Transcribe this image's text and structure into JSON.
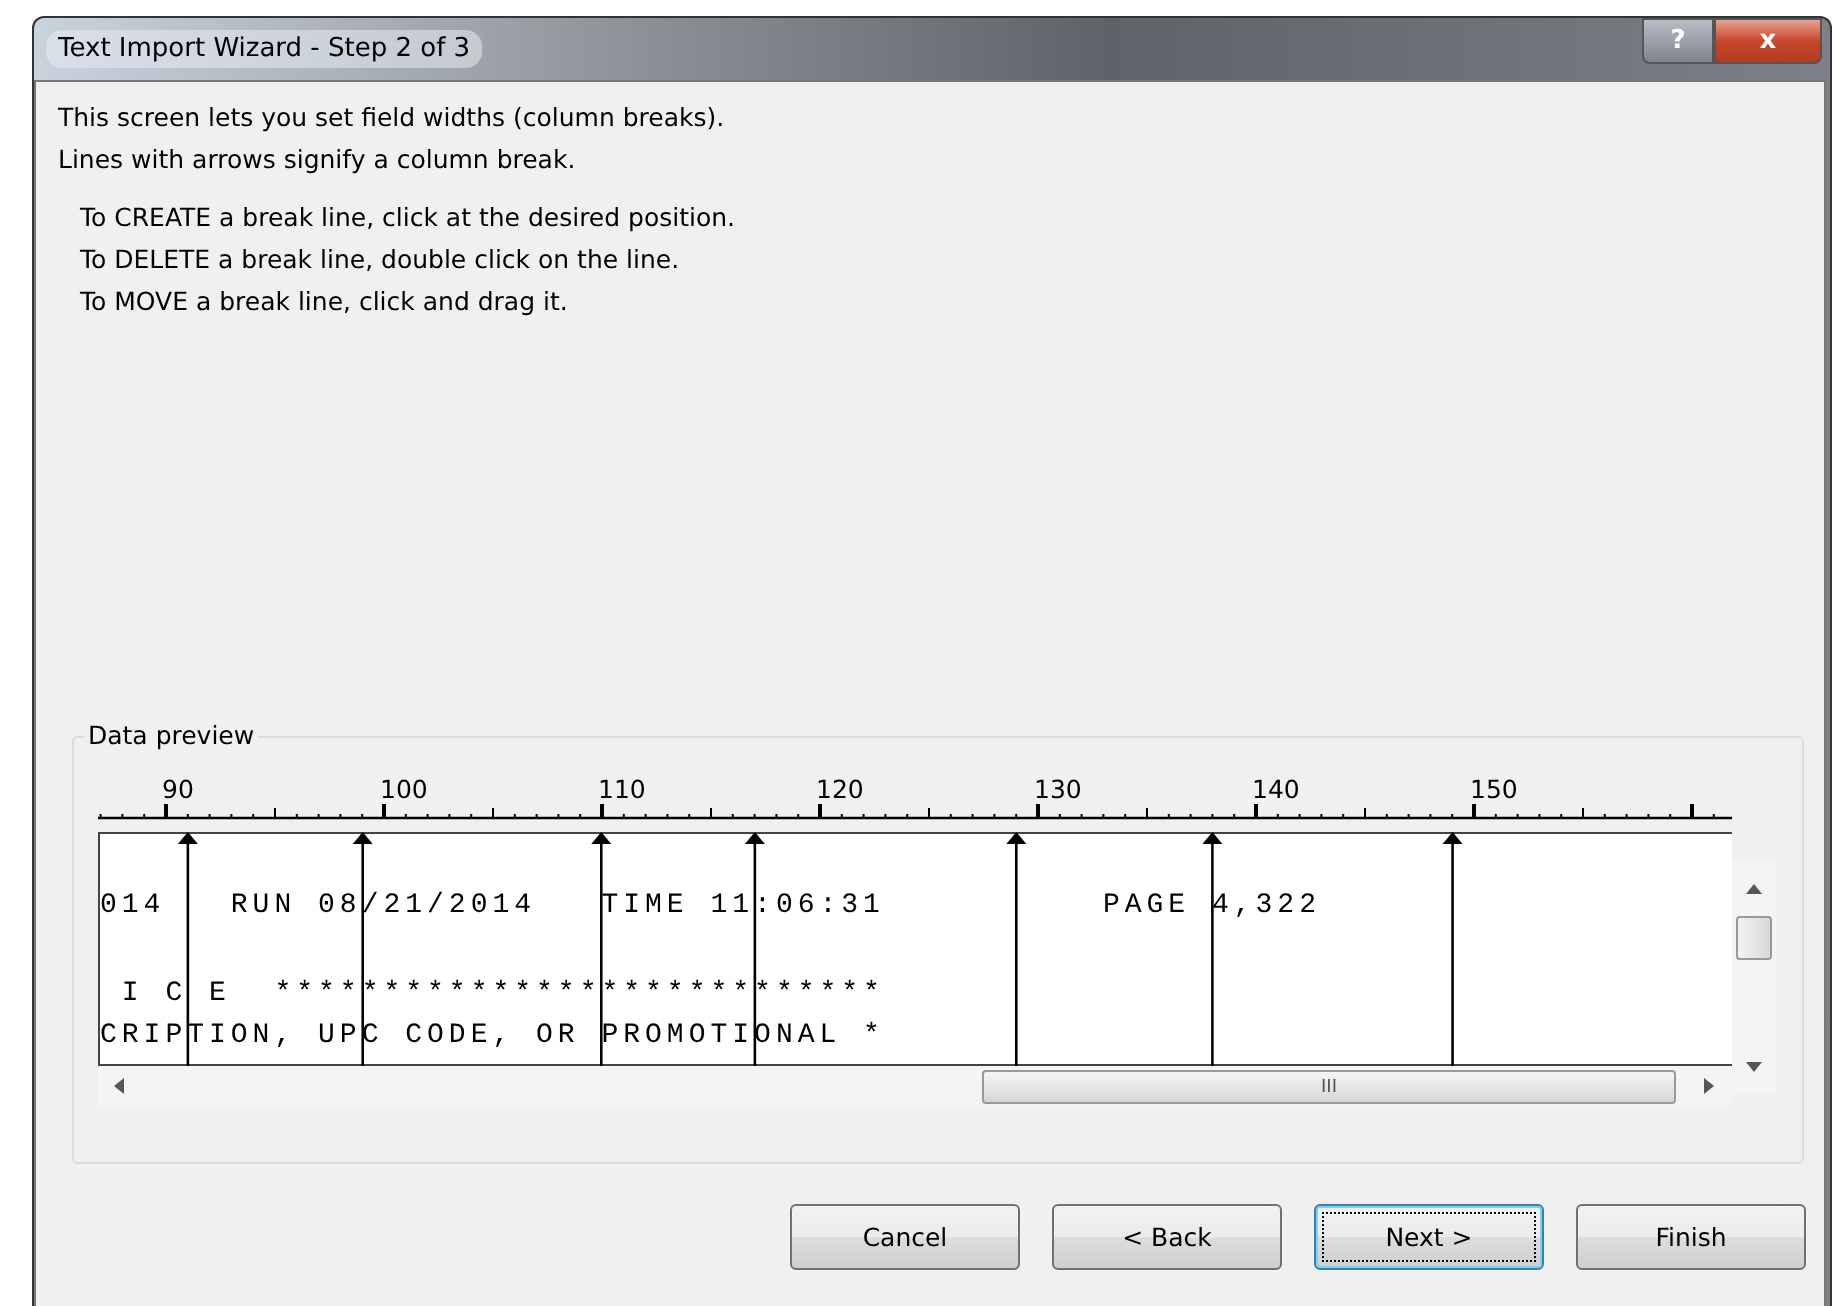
{
  "window": {
    "title": "Text Import Wizard - Step 2 of 3",
    "help_label": "?",
    "close_label": "x"
  },
  "intro": [
    "This screen lets you set field widths (column breaks).",
    "Lines with arrows signify a column break."
  ],
  "instructions": [
    "To CREATE a break line, click at the desired position.",
    "To DELETE a break line, double click on the line.",
    "To MOVE a break line, click and drag it."
  ],
  "preview": {
    "title": "Data preview",
    "ruler_labels": [
      "90",
      "100",
      "110",
      "120",
      "130",
      "140",
      "150"
    ],
    "column_breaks": [
      {
        "level": 0.055
      },
      {
        "level": 0.162
      },
      {
        "level": 0.308
      },
      {
        "level": 0.402
      },
      {
        "level": 0.562
      },
      {
        "level": 0.682
      },
      {
        "level": 0.829
      }
    ],
    "lines": [
      "014   RUN 08/21/2014   TIME 11:06:31          PAGE 4,322",
      " I C E  ****************************",
      "CRIPTION, UPC CODE, OR PROMOTIONAL *"
    ],
    "scroll_grip": "III"
  },
  "buttons": [
    {
      "label": "Cancel",
      "default": false
    },
    {
      "label": "< Back",
      "default": false
    },
    {
      "label": "Next >",
      "default": true
    },
    {
      "label": "Finish",
      "default": false
    }
  ]
}
